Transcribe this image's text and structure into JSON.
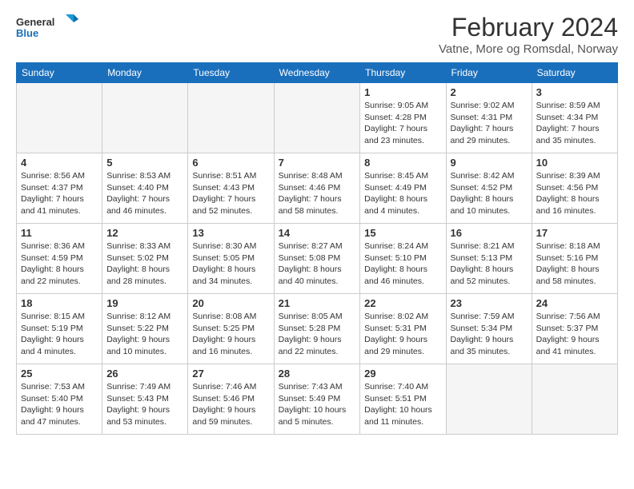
{
  "header": {
    "logo_line1": "General",
    "logo_line2": "Blue",
    "month": "February 2024",
    "location": "Vatne, More og Romsdal, Norway"
  },
  "days_of_week": [
    "Sunday",
    "Monday",
    "Tuesday",
    "Wednesday",
    "Thursday",
    "Friday",
    "Saturday"
  ],
  "weeks": [
    [
      {
        "day": "",
        "info": ""
      },
      {
        "day": "",
        "info": ""
      },
      {
        "day": "",
        "info": ""
      },
      {
        "day": "",
        "info": ""
      },
      {
        "day": "1",
        "info": "Sunrise: 9:05 AM\nSunset: 4:28 PM\nDaylight: 7 hours\nand 23 minutes."
      },
      {
        "day": "2",
        "info": "Sunrise: 9:02 AM\nSunset: 4:31 PM\nDaylight: 7 hours\nand 29 minutes."
      },
      {
        "day": "3",
        "info": "Sunrise: 8:59 AM\nSunset: 4:34 PM\nDaylight: 7 hours\nand 35 minutes."
      }
    ],
    [
      {
        "day": "4",
        "info": "Sunrise: 8:56 AM\nSunset: 4:37 PM\nDaylight: 7 hours\nand 41 minutes."
      },
      {
        "day": "5",
        "info": "Sunrise: 8:53 AM\nSunset: 4:40 PM\nDaylight: 7 hours\nand 46 minutes."
      },
      {
        "day": "6",
        "info": "Sunrise: 8:51 AM\nSunset: 4:43 PM\nDaylight: 7 hours\nand 52 minutes."
      },
      {
        "day": "7",
        "info": "Sunrise: 8:48 AM\nSunset: 4:46 PM\nDaylight: 7 hours\nand 58 minutes."
      },
      {
        "day": "8",
        "info": "Sunrise: 8:45 AM\nSunset: 4:49 PM\nDaylight: 8 hours\nand 4 minutes."
      },
      {
        "day": "9",
        "info": "Sunrise: 8:42 AM\nSunset: 4:52 PM\nDaylight: 8 hours\nand 10 minutes."
      },
      {
        "day": "10",
        "info": "Sunrise: 8:39 AM\nSunset: 4:56 PM\nDaylight: 8 hours\nand 16 minutes."
      }
    ],
    [
      {
        "day": "11",
        "info": "Sunrise: 8:36 AM\nSunset: 4:59 PM\nDaylight: 8 hours\nand 22 minutes."
      },
      {
        "day": "12",
        "info": "Sunrise: 8:33 AM\nSunset: 5:02 PM\nDaylight: 8 hours\nand 28 minutes."
      },
      {
        "day": "13",
        "info": "Sunrise: 8:30 AM\nSunset: 5:05 PM\nDaylight: 8 hours\nand 34 minutes."
      },
      {
        "day": "14",
        "info": "Sunrise: 8:27 AM\nSunset: 5:08 PM\nDaylight: 8 hours\nand 40 minutes."
      },
      {
        "day": "15",
        "info": "Sunrise: 8:24 AM\nSunset: 5:10 PM\nDaylight: 8 hours\nand 46 minutes."
      },
      {
        "day": "16",
        "info": "Sunrise: 8:21 AM\nSunset: 5:13 PM\nDaylight: 8 hours\nand 52 minutes."
      },
      {
        "day": "17",
        "info": "Sunrise: 8:18 AM\nSunset: 5:16 PM\nDaylight: 8 hours\nand 58 minutes."
      }
    ],
    [
      {
        "day": "18",
        "info": "Sunrise: 8:15 AM\nSunset: 5:19 PM\nDaylight: 9 hours\nand 4 minutes."
      },
      {
        "day": "19",
        "info": "Sunrise: 8:12 AM\nSunset: 5:22 PM\nDaylight: 9 hours\nand 10 minutes."
      },
      {
        "day": "20",
        "info": "Sunrise: 8:08 AM\nSunset: 5:25 PM\nDaylight: 9 hours\nand 16 minutes."
      },
      {
        "day": "21",
        "info": "Sunrise: 8:05 AM\nSunset: 5:28 PM\nDaylight: 9 hours\nand 22 minutes."
      },
      {
        "day": "22",
        "info": "Sunrise: 8:02 AM\nSunset: 5:31 PM\nDaylight: 9 hours\nand 29 minutes."
      },
      {
        "day": "23",
        "info": "Sunrise: 7:59 AM\nSunset: 5:34 PM\nDaylight: 9 hours\nand 35 minutes."
      },
      {
        "day": "24",
        "info": "Sunrise: 7:56 AM\nSunset: 5:37 PM\nDaylight: 9 hours\nand 41 minutes."
      }
    ],
    [
      {
        "day": "25",
        "info": "Sunrise: 7:53 AM\nSunset: 5:40 PM\nDaylight: 9 hours\nand 47 minutes."
      },
      {
        "day": "26",
        "info": "Sunrise: 7:49 AM\nSunset: 5:43 PM\nDaylight: 9 hours\nand 53 minutes."
      },
      {
        "day": "27",
        "info": "Sunrise: 7:46 AM\nSunset: 5:46 PM\nDaylight: 9 hours\nand 59 minutes."
      },
      {
        "day": "28",
        "info": "Sunrise: 7:43 AM\nSunset: 5:49 PM\nDaylight: 10 hours\nand 5 minutes."
      },
      {
        "day": "29",
        "info": "Sunrise: 7:40 AM\nSunset: 5:51 PM\nDaylight: 10 hours\nand 11 minutes."
      },
      {
        "day": "",
        "info": ""
      },
      {
        "day": "",
        "info": ""
      }
    ]
  ]
}
